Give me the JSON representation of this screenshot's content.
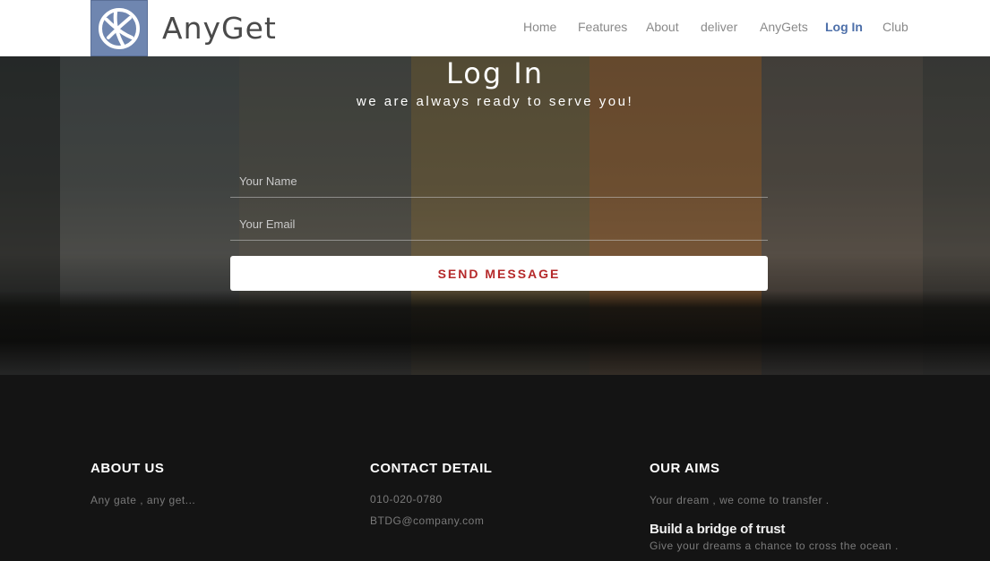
{
  "header": {
    "brand": "AnyGet",
    "logo_icon": "globe-icon",
    "nav": [
      {
        "label": "Home",
        "active": false
      },
      {
        "label": "Features",
        "active": false
      },
      {
        "label": "About",
        "active": false
      },
      {
        "label": "deliver",
        "active": false
      },
      {
        "label": "AnyGets",
        "active": false
      },
      {
        "label": "Log In",
        "active": true
      },
      {
        "label": "Club",
        "active": false
      }
    ]
  },
  "hero": {
    "title": "Log In",
    "subtitle": "we are always ready to serve you!",
    "name_placeholder": "Your Name",
    "email_placeholder": "Your Email",
    "button_label": "SEND MESSAGE"
  },
  "footer": {
    "about": {
      "title": "ABOUT US",
      "text": "Any gate , any get..."
    },
    "contact": {
      "title": "CONTACT DETAIL",
      "phone": "010-020-0780",
      "email": "BTDG@company.com"
    },
    "aims": {
      "title": "OUR AIMS",
      "text": "Your dream , we come to transfer .",
      "highlight": "Build a bridge of trust",
      "subtext": "Give your dreams a chance to cross the ocean ."
    }
  },
  "colors": {
    "accent": "#4d6fa9",
    "button_text": "#b5292a",
    "logo_bg": "#6f86b0",
    "footer_bg": "#141414"
  }
}
